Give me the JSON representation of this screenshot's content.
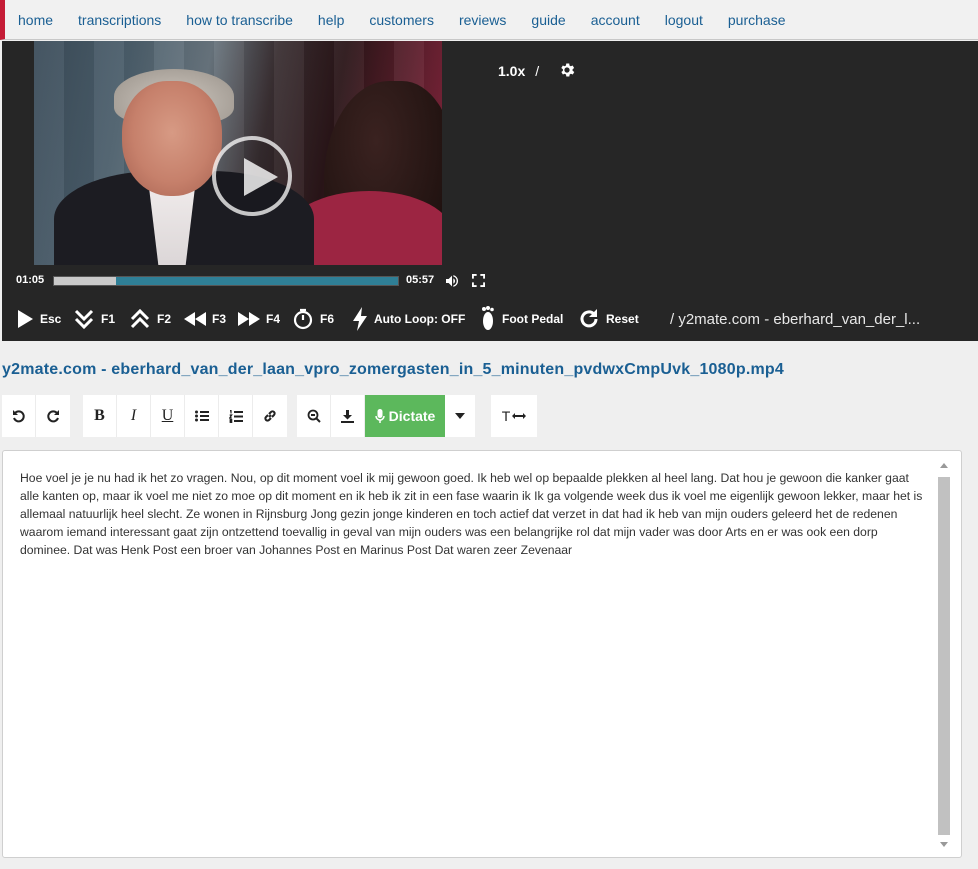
{
  "nav": {
    "items": [
      "home",
      "transcriptions",
      "how to transcribe",
      "help",
      "customers",
      "reviews",
      "guide",
      "account",
      "logout",
      "purchase"
    ]
  },
  "player": {
    "speed": "1.0x",
    "speed_sep": "/",
    "current_time": "01:05",
    "duration": "05:57",
    "progress_fraction": 0.18,
    "controls": {
      "play_key": "Esc",
      "rewind_key": "F1",
      "forward_key": "F2",
      "back_key": "F3",
      "ahead_key": "F4",
      "timestamp_key": "F6",
      "autoloop": "Auto Loop: OFF",
      "footpedal": "Foot Pedal",
      "reset": "Reset"
    },
    "filename_short": "/  y2mate.com - eberhard_van_der_l..."
  },
  "document": {
    "title": "y2mate.com - eberhard_van_der_laan_vpro_zomergasten_in_5_minuten_pvdwxCmpUvk_1080p.mp4"
  },
  "toolbar": {
    "dictate_label": "Dictate",
    "bold": "B",
    "italic": "I",
    "underline": "U",
    "font_label": "T"
  },
  "editor": {
    "text": "Hoe voel je je nu had ik het zo vragen. Nou, op dit moment voel ik mij gewoon goed. Ik heb wel op bepaalde plekken al heel lang. Dat hou je gewoon die kanker gaat alle kanten op, maar ik voel me niet zo moe op dit moment en ik heb ik zit in een fase waarin ik Ik ga volgende week dus ik voel me eigenlijk gewoon lekker, maar het is allemaal natuurlijk heel slecht. Ze wonen in Rijnsburg Jong gezin jonge kinderen en toch actief dat verzet in dat had ik heb van mijn ouders geleerd het de redenen waarom iemand interessant gaat zijn ontzettend toevallig in geval van mijn ouders was een belangrijke rol dat mijn vader was door Arts en er was ook een dorp dominee. Dat was Henk Post een broer van Johannes Post en Marinus Post Dat waren zeer Zevenaar"
  },
  "colors": {
    "link": "#1a5f93",
    "accent": "#c51c36",
    "player_bg": "#262626",
    "dictate_green": "#5cb85c"
  }
}
